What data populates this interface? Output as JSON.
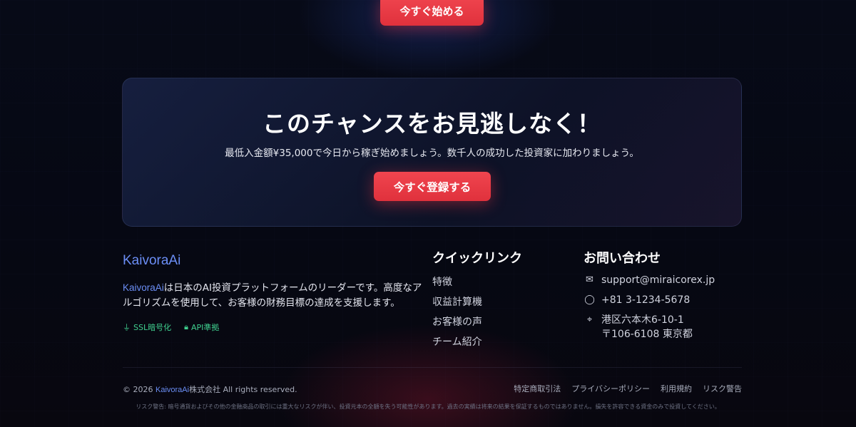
{
  "hero": {
    "start_button": "今すぐ始める"
  },
  "cta": {
    "title": "このチャンスをお見逃しなく！",
    "subtitle": "最低入金額¥35,000で今日から稼ぎ始めましょう。数千人の成功した投資家に加わりましょう。",
    "register_button": "今すぐ登録する"
  },
  "footer": {
    "brand": "KaivoraAi",
    "about_brand": "KaivoraAi",
    "about_text": "は日本のAI投資プラットフォームのリーダーです。高度なアルゴリズムを使用して、お客様の財務目標の達成を支援します。",
    "badges": [
      {
        "icon": "plug-icon",
        "label": "SSL暗号化"
      },
      {
        "icon": "lock-icon",
        "label": "API準拠"
      }
    ],
    "quick_links": {
      "title": "クイックリンク",
      "items": [
        "特徴",
        "収益計算機",
        "お客様の声",
        "チーム紹介"
      ]
    },
    "contact": {
      "title": "お問い合わせ",
      "email": "support@miraicorex.jp",
      "phone": "+81 3-1234-5678",
      "address_line1": "港区六本木6-10-1",
      "address_line2": "〒106-6108 東京都"
    },
    "copyright_prefix": "© 2026 ",
    "copyright_brand": "KaivoraAi",
    "copyright_suffix": "株式会社 All rights reserved.",
    "legal_links": [
      "特定商取引法",
      "プライバシーポリシー",
      "利用規約",
      "リスク警告"
    ],
    "risk_warning": "リスク警告: 暗号通貨およびその他の金融商品の取引には重大なリスクが伴い、投資元本の全額を失う可能性があります。過去の実績は将来の結果を保証するものではありません。損失を許容できる資金のみで投資してください。"
  },
  "colors": {
    "accent_red": "#e8363f",
    "brand_blue": "#6b8ef5",
    "badge_green": "#3fcf8e",
    "background": "#070914"
  }
}
